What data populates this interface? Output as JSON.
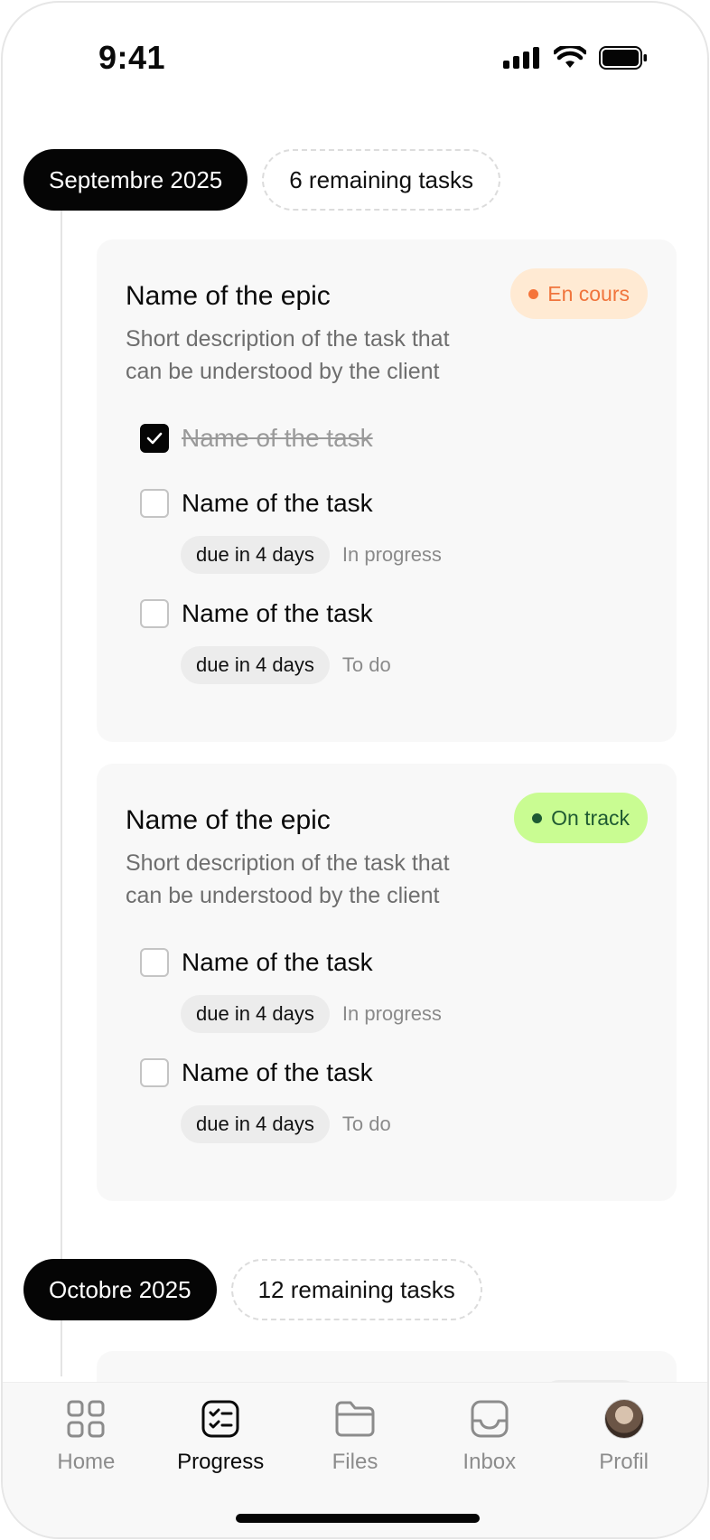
{
  "status_bar": {
    "time": "9:41"
  },
  "months": [
    {
      "label": "Septembre 2025",
      "remaining": "6 remaining tasks"
    },
    {
      "label": "Octobre 2025",
      "remaining": "12 remaining tasks"
    }
  ],
  "epics": [
    {
      "title": "Name of the epic",
      "description": "Short description of the task that can be understood by the client",
      "status": {
        "label": "En cours",
        "bg": "#ffead3",
        "text": "#f0743c",
        "dot": "#f5743a"
      },
      "tasks": [
        {
          "name": "Name of the task",
          "checked": true
        },
        {
          "name": "Name of the task",
          "checked": false,
          "due": "due in 4 days",
          "state": "In progress"
        },
        {
          "name": "Name of the task",
          "checked": false,
          "due": "due in 4 days",
          "state": "To do"
        }
      ]
    },
    {
      "title": "Name of the epic",
      "description": "Short description of the task that can be understood by the client",
      "status": {
        "label": "On track",
        "bg": "#c9fc92",
        "text": "#1f5a32",
        "dot": "#1d5a33"
      },
      "tasks": [
        {
          "name": "Name of the task",
          "checked": false,
          "due": "due in 4 days",
          "state": "In progress"
        },
        {
          "name": "Name of the task",
          "checked": false,
          "due": "due in 4 days",
          "state": "To do"
        }
      ]
    }
  ],
  "nav": {
    "items": [
      {
        "label": "Home",
        "icon": "home-grid-icon"
      },
      {
        "label": "Progress",
        "icon": "progress-checklist-icon",
        "active": true
      },
      {
        "label": "Files",
        "icon": "folder-icon"
      },
      {
        "label": "Inbox",
        "icon": "inbox-icon"
      },
      {
        "label": "Profil",
        "icon": "avatar"
      }
    ]
  },
  "colors": {
    "accent": "#050505",
    "card_bg": "#f8f8f8"
  }
}
